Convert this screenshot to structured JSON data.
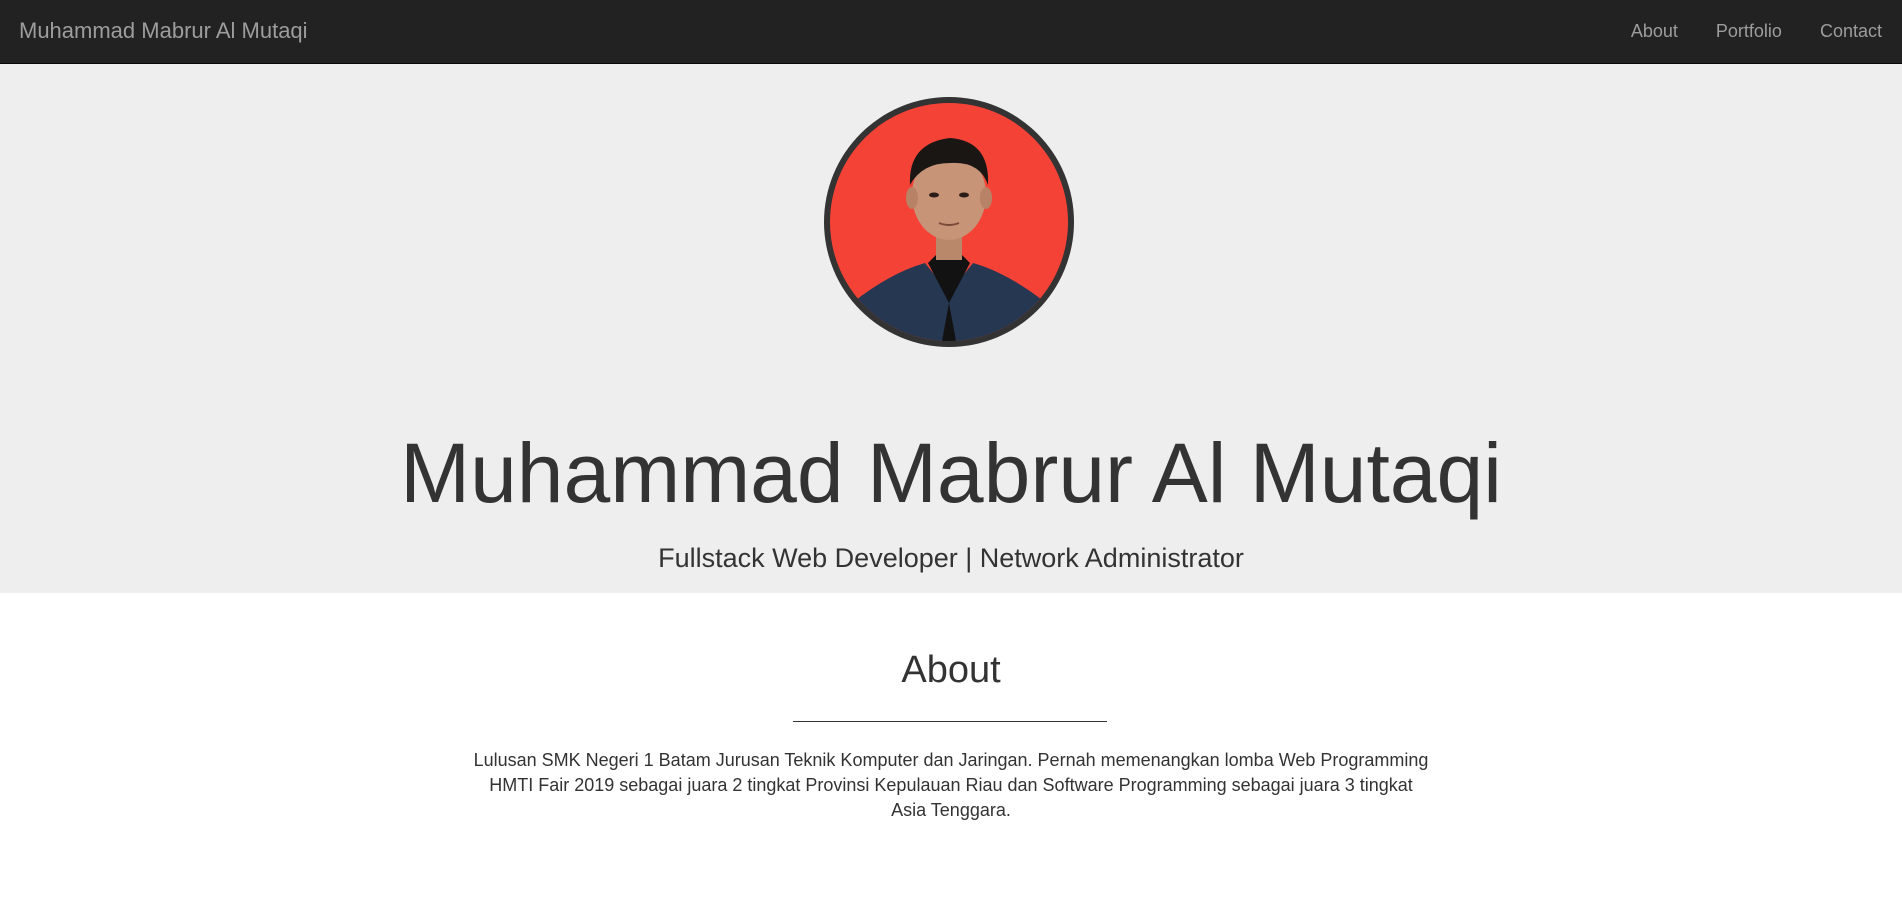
{
  "navbar": {
    "brand": "Muhammad Mabrur Al Mutaqi",
    "links": [
      {
        "label": "About"
      },
      {
        "label": "Portfolio"
      },
      {
        "label": "Contact"
      }
    ]
  },
  "hero": {
    "avatar_icon": "profile-photo",
    "name": "Muhammad Mabrur Al Mutaqi",
    "subtitle": "Fullstack Web Developer | Network Administrator"
  },
  "about": {
    "title": "About",
    "text": "Lulusan SMK Negeri 1 Batam Jurusan Teknik Komputer dan Jaringan. Pernah memenangkan lomba Web Programming HMTI Fair 2019 sebagai juara 2 tingkat Provinsi Kepulauan Riau dan Software Programming sebagai juara 3 tingkat Asia Tenggara."
  },
  "colors": {
    "navbar_bg": "#222222",
    "nav_text": "#9d9d9d",
    "hero_bg": "#eeeeee",
    "text": "#333333",
    "avatar_bg": "#f44336"
  }
}
